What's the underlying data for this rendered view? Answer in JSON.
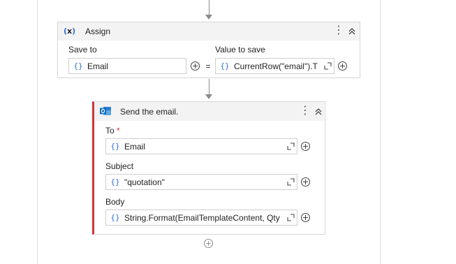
{
  "assign": {
    "title": "Assign",
    "icon": "variable-x-icon",
    "save_to_label": "Save to",
    "value_label": "Value to save",
    "save_to_value": "Email",
    "value_value": "CurrentRow(\"email\").T",
    "equals": "="
  },
  "send_email": {
    "title": "Send the email.",
    "icon": "outlook-icon",
    "accent_color": "#d13438",
    "to_label": "To",
    "required_mark": "*",
    "to_value": "Email",
    "subject_label": "Subject",
    "subject_value": "\"quotation\"",
    "body_label": "Body",
    "body_value": "String.Format(EmailTemplateContent, Qty"
  },
  "field_prefix": "{}",
  "colors": {
    "brace_blue": "#2f6fd6",
    "outlook_blue": "#0f6cbd"
  }
}
